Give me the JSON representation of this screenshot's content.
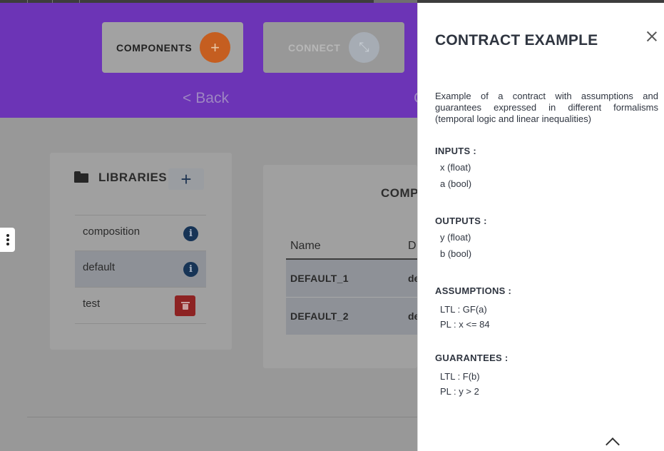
{
  "toolbar": {
    "components_label": "COMPONENTS",
    "components_icon": "+",
    "connect_label": "CONNECT",
    "connect_icon": "⤡",
    "back_label": "Back",
    "back_icon": "<"
  },
  "libraries": {
    "title": "LIBRARIES",
    "add_icon": "+",
    "items": [
      {
        "label": "composition",
        "action_icon": "info-icon",
        "selected": false
      },
      {
        "label": "default",
        "action_icon": "info-icon",
        "selected": true
      },
      {
        "label": "test",
        "action_icon": "trash-icon",
        "selected": false
      }
    ],
    "info_glyph": "i"
  },
  "components": {
    "title": "COMP",
    "headers": [
      "Name",
      "D"
    ],
    "rows": [
      {
        "name": "DEFAULT_1",
        "d": "de"
      },
      {
        "name": "DEFAULT_2",
        "d": "de"
      }
    ]
  },
  "ghost_text": "C",
  "panel": {
    "title": "CONTRACT EXAMPLE",
    "description": "Example of a contract with assumptions and guarantees expressed in different formalisms (temporal logic and linear inequalities)",
    "inputs": {
      "heading": "INPUTS :",
      "items": [
        "x (float)",
        "a (bool)"
      ]
    },
    "outputs": {
      "heading": "OUTPUTS :",
      "items": [
        "y (float)",
        "b (bool)"
      ]
    },
    "assumptions": {
      "heading": "ASSUMPTIONS :",
      "items": [
        "LTL : GF(a)",
        "PL : x <= 84"
      ]
    },
    "guarantees": {
      "heading": "GUARANTEES :",
      "items": [
        "LTL : F(b)",
        "PL : y > 2"
      ]
    }
  },
  "colors": {
    "header_purple": "#6c34b6",
    "accent_orange": "#c55e20",
    "danger_red": "#8d2323",
    "info_navy": "#173456"
  }
}
